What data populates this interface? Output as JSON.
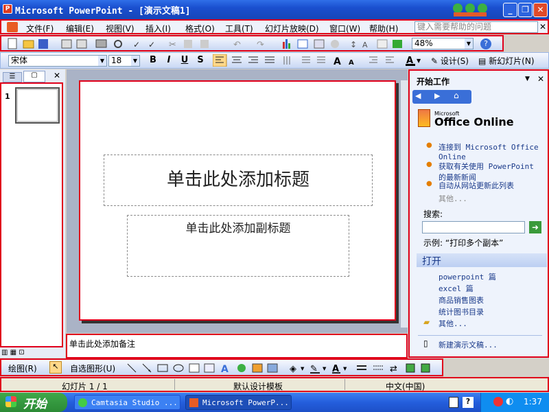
{
  "window": {
    "title": "Microsoft PowerPoint - [演示文稿1]",
    "app_icon": "P",
    "min": "_",
    "max": "❐",
    "close": "✕"
  },
  "menu": {
    "items": [
      "文件(F)",
      "编辑(E)",
      "视图(V)",
      "插入(I)",
      "格式(O)",
      "工具(T)",
      "幻灯片放映(D)",
      "窗口(W)",
      "帮助(H)"
    ],
    "help_placeholder": "键入需要帮助的问题",
    "close": "✕"
  },
  "toolbar": {
    "zoom": "48%"
  },
  "format": {
    "font": "宋体",
    "size": "18",
    "bold": "B",
    "italic": "I",
    "underline": "U",
    "shadow": "S",
    "design": "设计(S)",
    "new_slide": "新幻灯片(N)"
  },
  "thumbnails": {
    "slide_number": "1"
  },
  "slide": {
    "title_placeholder": "单击此处添加标题",
    "subtitle_placeholder": "单击此处添加副标题"
  },
  "notes": {
    "placeholder": "单击此处添加备注"
  },
  "taskpane": {
    "title": "开始工作",
    "brand_small": "Microsoft",
    "brand": "Office Online",
    "links": [
      "连接到 Microsoft Office Online",
      "获取有关使用 PowerPoint 的最新新闻",
      "自动从网站更新此列表"
    ],
    "more": "其他...",
    "search_label": "搜索:",
    "example": "示例:  “打印多个副本”",
    "open_header": "打开",
    "files": [
      "powerpoint 篇",
      "excel 篇",
      "商品销售图表",
      "统计图书目录"
    ],
    "open_more": "其他...",
    "new_presentation": "新建演示文稿..."
  },
  "drawing": {
    "draw_menu": "绘图(R)",
    "autoshapes": "自选图形(U)"
  },
  "status": {
    "slide": "幻灯片 1 / 1",
    "template": "默认设计模板",
    "language": "中文(中国)"
  },
  "taskbar": {
    "start": "开始",
    "tasks": [
      "Camtasia Studio ...",
      "Microsoft PowerP..."
    ],
    "clock": "1:37"
  }
}
